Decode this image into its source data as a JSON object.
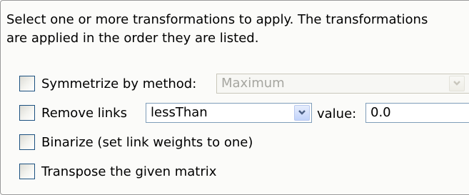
{
  "description": {
    "line1": "Select one or more transformations to apply. The transformations",
    "line2": "are applied in the order they are listed."
  },
  "symmetrize": {
    "label": "Symmetrize by method:",
    "method_value": "Maximum",
    "checked": false,
    "enabled": false
  },
  "remove_links": {
    "label": "Remove links",
    "condition_value": "lessThan",
    "value_label": "value:",
    "value": "0.0",
    "checked": false
  },
  "binarize": {
    "label": "Binarize (set link weights to one)",
    "checked": false
  },
  "transpose": {
    "label": "Transpose the given matrix",
    "checked": false
  },
  "colors": {
    "checkbox_border": "#1c5180",
    "input_border": "#7f9db9",
    "panel_border": "#9a9a9a"
  }
}
